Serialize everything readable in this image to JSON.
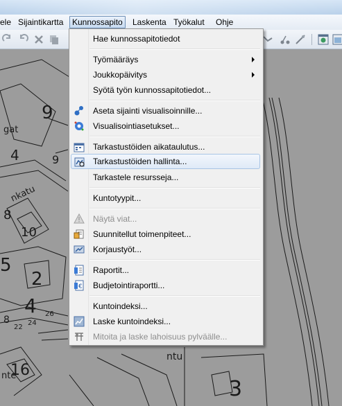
{
  "menubar": {
    "items": [
      {
        "label": "ele"
      },
      {
        "label": "Sijaintikartta"
      },
      {
        "label": "Kunnossapito"
      },
      {
        "label": "Laskenta"
      },
      {
        "label": "Työkalut"
      },
      {
        "label": "Ohje"
      }
    ]
  },
  "map": {
    "labels": [
      "9",
      "4",
      "9",
      "8",
      "10",
      "5",
      "2",
      "4",
      "8",
      "26",
      "24",
      "22",
      "16",
      "3",
      "ntu",
      "nte",
      "nkatu",
      "gat"
    ]
  },
  "dropdown": {
    "items": [
      {
        "label": "Hae kunnossapitotiedot",
        "icon": "",
        "disabled": false,
        "submenu": false
      },
      {
        "label": "Työmääräys",
        "icon": "",
        "disabled": false,
        "submenu": true
      },
      {
        "label": "Joukkopäivitys",
        "icon": "",
        "disabled": false,
        "submenu": true
      },
      {
        "label": "Syötä työn kunnossapitotiedot...",
        "icon": "",
        "disabled": false,
        "submenu": false
      },
      {
        "label": "Aseta sijainti visualisoinnille...",
        "icon": "location-pin-icon",
        "disabled": false,
        "submenu": false
      },
      {
        "label": "Visualisointiasetukset...",
        "icon": "visualization-settings-icon",
        "disabled": false,
        "submenu": false
      },
      {
        "label": "Tarkastustöiden aikataulutus...",
        "icon": "schedule-icon",
        "disabled": false,
        "submenu": false
      },
      {
        "label": "Tarkastustöiden hallinta...",
        "icon": "inspection-management-icon",
        "disabled": false,
        "submenu": false,
        "highlighted": true
      },
      {
        "label": "Tarkastele resursseja...",
        "icon": "",
        "disabled": false,
        "submenu": false
      },
      {
        "label": "Kuntotyypit...",
        "icon": "",
        "disabled": false,
        "submenu": false
      },
      {
        "label": "Näytä viat...",
        "icon": "warning-icon",
        "disabled": true,
        "submenu": false
      },
      {
        "label": "Suunnitellut toimenpiteet...",
        "icon": "planned-actions-icon",
        "disabled": false,
        "submenu": false
      },
      {
        "label": "Korjaustyöt...",
        "icon": "repair-works-icon",
        "disabled": false,
        "submenu": false
      },
      {
        "label": "Raportit...",
        "icon": "reports-icon",
        "disabled": false,
        "submenu": false
      },
      {
        "label": "Budjetointiraportti...",
        "icon": "budget-report-icon",
        "disabled": false,
        "submenu": false
      },
      {
        "label": "Kuntoindeksi...",
        "icon": "",
        "disabled": false,
        "submenu": false
      },
      {
        "label": "Laske kuntoindeksi...",
        "icon": "calculate-index-icon",
        "disabled": false,
        "submenu": false
      },
      {
        "label": "Mitoita ja laske lahoisuus pylväälle...",
        "icon": "pole-decay-icon",
        "disabled": true,
        "submenu": false
      }
    ]
  }
}
